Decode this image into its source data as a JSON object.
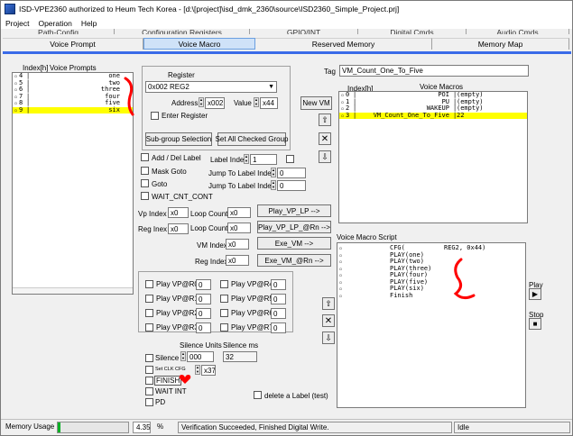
{
  "window": {
    "title": "ISD-VPE2360 authorized to Heum Tech Korea - [d:\\[project]\\isd_dmk_2360\\source\\ISD2360_Simple_Project.prj]"
  },
  "menu": [
    "Project",
    "Operation",
    "Help"
  ],
  "tabs_back": [
    "Path-Config",
    "Configuration Registers",
    "GPIO/INT",
    "Digital Cmds",
    "Audio Cmds"
  ],
  "tabs_front": [
    "Voice Prompt",
    "Voice Macro",
    "Reserved Memory",
    "Memory Map"
  ],
  "active_tab": "Voice Macro",
  "voice_prompts": {
    "header_index": "Index[h]",
    "header_title": "Voice Prompts",
    "rows": [
      {
        "index": "4",
        "name": "one"
      },
      {
        "index": "5",
        "name": "two"
      },
      {
        "index": "6",
        "name": "three"
      },
      {
        "index": "7",
        "name": "four"
      },
      {
        "index": "8",
        "name": "five"
      },
      {
        "index": "9",
        "name": "six"
      }
    ],
    "selected_index": "9"
  },
  "register": {
    "label": "Register",
    "selected": "0x002 REG2",
    "address_label": "Address",
    "address_value": "x002",
    "value_label": "Value",
    "value_value": "x44",
    "enter_register_label": "Enter Register",
    "subgroup_button": "Sub-group Selection",
    "set_all_button": "Set All Checked Group"
  },
  "new_vm_button": "New VM",
  "tag": {
    "label": "Tag",
    "value": "VM_Count_One_To_Five"
  },
  "voice_macros": {
    "header_index": "Index[h]",
    "header_title": "Voice Macros",
    "rows": [
      {
        "index": "0",
        "name": "POI",
        "size": "(empty)"
      },
      {
        "index": "1",
        "name": "PU",
        "size": "(empty)"
      },
      {
        "index": "2",
        "name": "WAKEUP",
        "size": "(empty)"
      },
      {
        "index": "3",
        "name": "VM_Count_One_To_Five",
        "size": "22"
      }
    ],
    "selected_index": "3"
  },
  "labels_section": {
    "add_del_label": "Add / Del Label",
    "label_index_label": "Label Index",
    "label_index_value": "1",
    "mask_goto": "Mask Goto",
    "jump_label_1": "Jump To Label Index",
    "jump_value_1": "0",
    "goto": "Goto",
    "jump_label_2": "Jump To Label Index",
    "jump_value_2": "0",
    "wait_cnt_cont": "WAIT_CNT_CONT"
  },
  "play_section": {
    "vp_index_label": "Vp Index",
    "vp_index_value": "x0",
    "loop_count_label_1": "Loop Count",
    "loop_count_value_1": "x0",
    "play_vp_lp_button": "Play_VP_LP  -->",
    "reg_index_label": "Reg Inex",
    "reg_index_value": "x0",
    "loop_count_label_2": "Loop Count",
    "loop_count_value_2": "x0",
    "play_vp_rn_button": "Play_VP_LP_@Rn -->",
    "vm_index_label": "VM Index",
    "vm_index_value": "x0",
    "exe_vm_button": "Exe_VM  -->",
    "reg_index2_label": "Reg Index",
    "reg_index2_value": "x0",
    "exe_vm_rn_button": "Exe_VM_@Rn  -->"
  },
  "play_regs": [
    {
      "label": "Play VP@R0",
      "value": "0"
    },
    {
      "label": "Play VP@R4",
      "value": "0"
    },
    {
      "label": "Play VP@R1",
      "value": "0"
    },
    {
      "label": "Play VP@R5",
      "value": "0"
    },
    {
      "label": "Play VP@R2",
      "value": "0"
    },
    {
      "label": "Play VP@R6",
      "value": "0"
    },
    {
      "label": "Play VP@R3",
      "value": "0"
    },
    {
      "label": "Play VP@R7",
      "value": "0"
    }
  ],
  "silence_section": {
    "units_label": "Silence Units",
    "ms_label": "Silence ms",
    "silence_label": "Silence",
    "silence_value": "000",
    "silence_ms_value": "32",
    "set_clk_label": "Set CLK CFG",
    "set_clk_value": "x37",
    "finish_label": "FINISH",
    "wait_int_label": "WAIT INT",
    "pd_label": "PD",
    "delete_label": "delete a Label (test)"
  },
  "script": {
    "title": "Voice Macro Script",
    "lines": [
      {
        "cmd": "CFG(",
        "arg": "REG2, 0x44)"
      },
      {
        "cmd": "PLAY(one)",
        "arg": ""
      },
      {
        "cmd": "PLAY(two)",
        "arg": ""
      },
      {
        "cmd": "PLAY(three)",
        "arg": ""
      },
      {
        "cmd": "PLAY(four)",
        "arg": ""
      },
      {
        "cmd": "PLAY(five)",
        "arg": ""
      },
      {
        "cmd": "PLAY(six)",
        "arg": ""
      },
      {
        "cmd": "Finish",
        "arg": ""
      }
    ]
  },
  "playback": {
    "play_label": "Play",
    "stop_label": "Stop"
  },
  "statusbar": {
    "memory_usage_label": "Memory Usage",
    "percent_value": "4.35",
    "percent_unit": "%",
    "memory_fraction": 0.0435,
    "message": "Verification Succeeded, Finished Digital Write.",
    "state": "Idle"
  },
  "colors": {
    "tab_active": "#cfe2f8",
    "accent_line": "#3a6be8",
    "highlight": "#ffff00",
    "annotation_red": "#ff0000",
    "progress": "#06b025"
  }
}
